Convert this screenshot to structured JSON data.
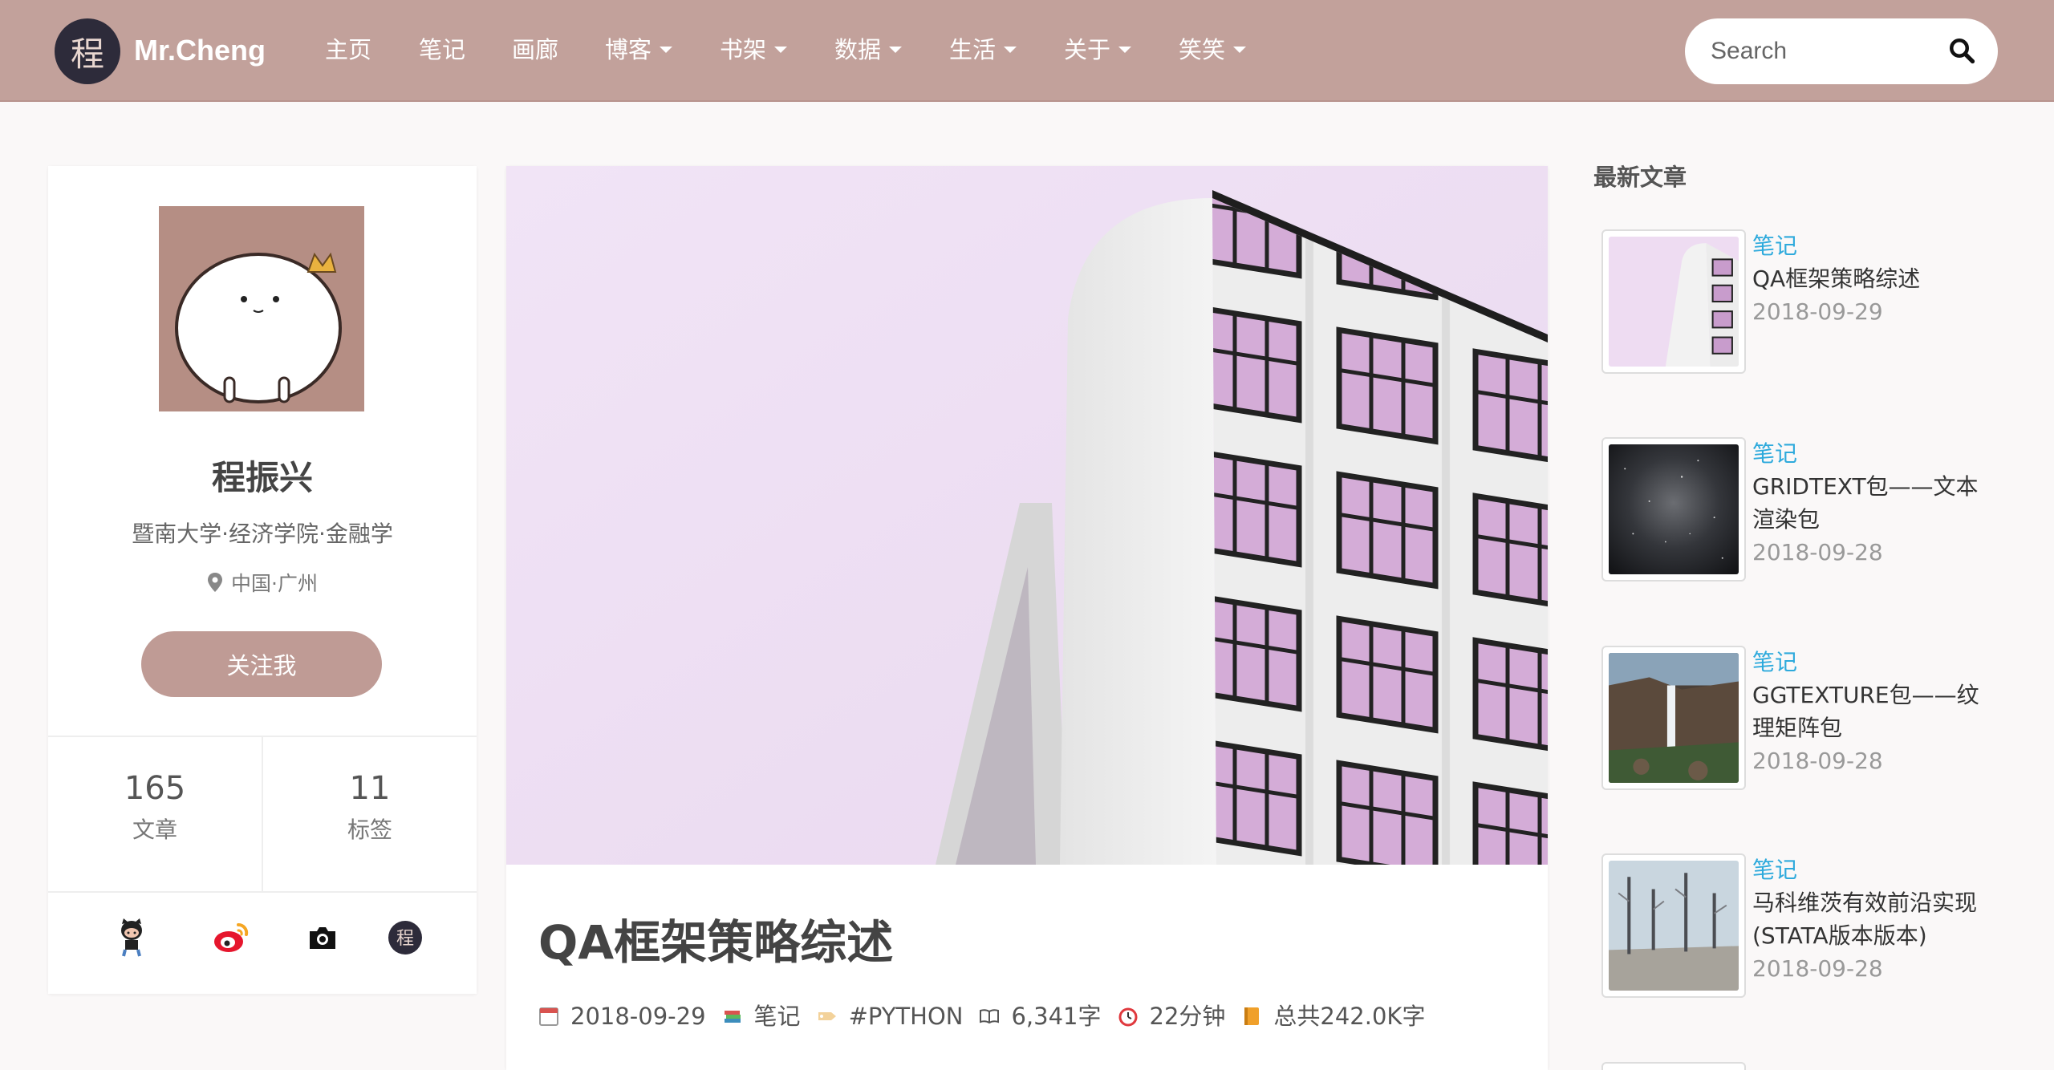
{
  "brand": {
    "logo_char": "程",
    "name": "Mr.Cheng"
  },
  "nav": {
    "items": [
      {
        "label": "主页",
        "dropdown": false
      },
      {
        "label": "笔记",
        "dropdown": false
      },
      {
        "label": "画廊",
        "dropdown": false
      },
      {
        "label": "博客",
        "dropdown": true
      },
      {
        "label": "书架",
        "dropdown": true
      },
      {
        "label": "数据",
        "dropdown": true
      },
      {
        "label": "生活",
        "dropdown": true
      },
      {
        "label": "关于",
        "dropdown": true
      },
      {
        "label": "笑笑",
        "dropdown": true
      }
    ],
    "search_placeholder": "Search"
  },
  "profile": {
    "name": "程振兴",
    "school": "暨南大学·经济学院·金融学",
    "location": "中国·广州",
    "follow_label": "关注我",
    "stats": [
      {
        "value": "165",
        "label": "文章"
      },
      {
        "value": "11",
        "label": "标签"
      }
    ],
    "social_icons": [
      "github-icon",
      "weibo-icon",
      "camera-icon",
      "blog-logo-icon"
    ],
    "social_logo_char": "程"
  },
  "post": {
    "title": "QA框架策略综述",
    "meta": {
      "date": "2018-09-29",
      "category": "笔记",
      "tag": "#PYTHON",
      "words": "6,341字",
      "read_time": "22分钟",
      "total": "总共242.0K字"
    }
  },
  "recent": {
    "heading": "最新文章",
    "items": [
      {
        "category": "笔记",
        "title": "QA框架策略综述",
        "date": "2018-09-29",
        "thumb": "building"
      },
      {
        "category": "笔记",
        "title": "GRIDTEXT包——文本渲染包",
        "date": "2018-09-28",
        "thumb": "galaxy"
      },
      {
        "category": "笔记",
        "title": "GGTEXTURE包——纹理矩阵包",
        "date": "2018-09-28",
        "thumb": "waterfall"
      },
      {
        "category": "笔记",
        "title": "马科维茨有效前沿实现(STATA版本版本)",
        "date": "2018-09-28",
        "thumb": "forest"
      }
    ]
  },
  "colors": {
    "navbar": "#c2a19b",
    "accent": "#bf9b95",
    "link": "#2eaadc",
    "logo_bg": "#2d2b3a"
  }
}
